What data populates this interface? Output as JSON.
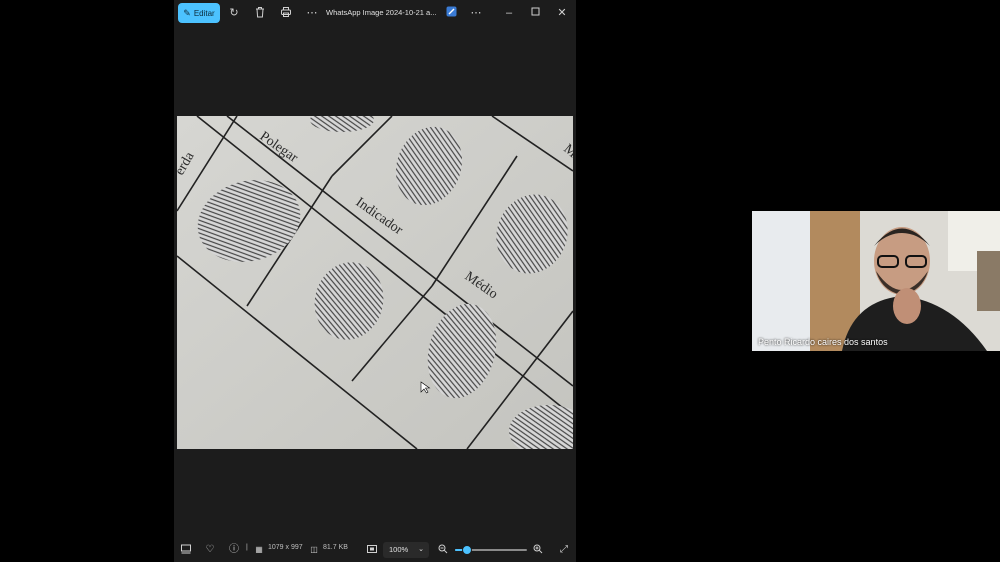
{
  "viewer": {
    "edit_label": "Editar",
    "title": "WhatsApp Image 2024-10-21 a...",
    "photo_labels": {
      "left": "erda",
      "polegar": "Polegar",
      "indicador": "Indicador",
      "medio": "Médio",
      "right": "M"
    },
    "status": {
      "dimensions": "1079 x 997",
      "filesize": "81.7 KB",
      "zoom": "100%",
      "zoom_level": 0.16
    }
  },
  "participant": {
    "name": "Pento Ricardo caires dos santos"
  },
  "colors": {
    "accent": "#4cc2ff",
    "viewer_bg": "#1c1c1c",
    "page_bg": "#000000"
  }
}
